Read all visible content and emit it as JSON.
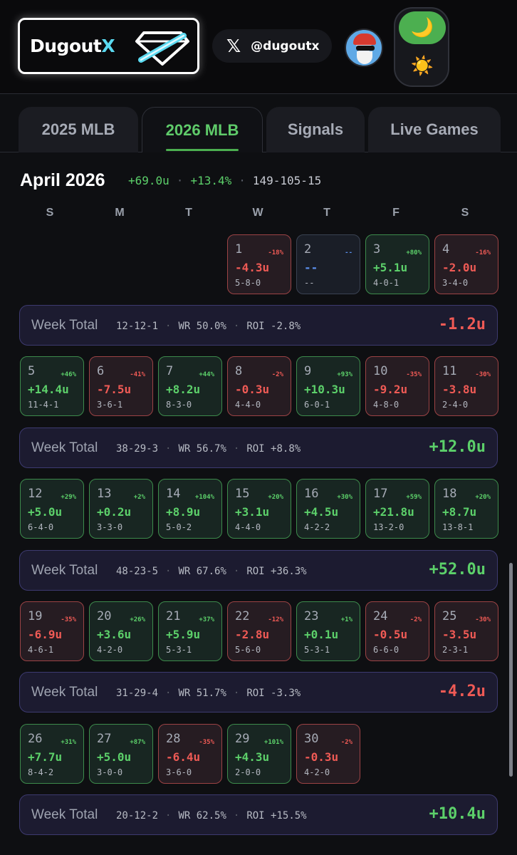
{
  "header": {
    "logo_text": "Dugout",
    "logo_accent": "X",
    "x_glyph": "𝕏",
    "x_handle": "@dugoutx",
    "moon_glyph": "🌙",
    "sun_glyph": "☀️"
  },
  "tabs": [
    {
      "label": "2025 MLB",
      "active": false
    },
    {
      "label": "2026 MLB",
      "active": true
    },
    {
      "label": "Signals",
      "active": false
    },
    {
      "label": "Live Games",
      "active": false
    }
  ],
  "month": {
    "title": "April 2026",
    "units": "+69.0u",
    "roi": "+13.4%",
    "record": "149-105-15",
    "sep": "·"
  },
  "weekdays": [
    "S",
    "M",
    "T",
    "W",
    "T",
    "F",
    "S"
  ],
  "weeks": [
    {
      "days": [
        {
          "col": 3,
          "num": "1",
          "pct": "-18%",
          "units": "-4.3u",
          "rec": "5-8-0",
          "status": "loss"
        },
        {
          "col": 4,
          "num": "2",
          "pct": "--",
          "units": "--",
          "rec": "--",
          "status": "empty"
        },
        {
          "col": 5,
          "num": "3",
          "pct": "+80%",
          "units": "+5.1u",
          "rec": "4-0-1",
          "status": "win"
        },
        {
          "col": 6,
          "num": "4",
          "pct": "-16%",
          "units": "-2.0u",
          "rec": "3-4-0",
          "status": "loss"
        }
      ],
      "total": {
        "label": "Week Total",
        "record": "12-12-1",
        "wr": "WR 50.0%",
        "roi": "ROI -2.8%",
        "units": "-1.2u",
        "status": "loss"
      }
    },
    {
      "days": [
        {
          "col": 0,
          "num": "5",
          "pct": "+46%",
          "units": "+14.4u",
          "rec": "11-4-1",
          "status": "win"
        },
        {
          "col": 1,
          "num": "6",
          "pct": "-41%",
          "units": "-7.5u",
          "rec": "3-6-1",
          "status": "loss"
        },
        {
          "col": 2,
          "num": "7",
          "pct": "+44%",
          "units": "+8.2u",
          "rec": "8-3-0",
          "status": "win"
        },
        {
          "col": 3,
          "num": "8",
          "pct": "-2%",
          "units": "-0.3u",
          "rec": "4-4-0",
          "status": "loss"
        },
        {
          "col": 4,
          "num": "9",
          "pct": "+93%",
          "units": "+10.3u",
          "rec": "6-0-1",
          "status": "win"
        },
        {
          "col": 5,
          "num": "10",
          "pct": "-35%",
          "units": "-9.2u",
          "rec": "4-8-0",
          "status": "loss"
        },
        {
          "col": 6,
          "num": "11",
          "pct": "-30%",
          "units": "-3.8u",
          "rec": "2-4-0",
          "status": "loss"
        }
      ],
      "total": {
        "label": "Week Total",
        "record": "38-29-3",
        "wr": "WR 56.7%",
        "roi": "ROI +8.8%",
        "units": "+12.0u",
        "status": "win"
      }
    },
    {
      "days": [
        {
          "col": 0,
          "num": "12",
          "pct": "+29%",
          "units": "+5.0u",
          "rec": "6-4-0",
          "status": "win"
        },
        {
          "col": 1,
          "num": "13",
          "pct": "+2%",
          "units": "+0.2u",
          "rec": "3-3-0",
          "status": "win"
        },
        {
          "col": 2,
          "num": "14",
          "pct": "+104%",
          "units": "+8.9u",
          "rec": "5-0-2",
          "status": "win"
        },
        {
          "col": 3,
          "num": "15",
          "pct": "+20%",
          "units": "+3.1u",
          "rec": "4-4-0",
          "status": "win"
        },
        {
          "col": 4,
          "num": "16",
          "pct": "+30%",
          "units": "+4.5u",
          "rec": "4-2-2",
          "status": "win"
        },
        {
          "col": 5,
          "num": "17",
          "pct": "+59%",
          "units": "+21.8u",
          "rec": "13-2-0",
          "status": "win"
        },
        {
          "col": 6,
          "num": "18",
          "pct": "+20%",
          "units": "+8.7u",
          "rec": "13-8-1",
          "status": "win"
        }
      ],
      "total": {
        "label": "Week Total",
        "record": "48-23-5",
        "wr": "WR 67.6%",
        "roi": "ROI +36.3%",
        "units": "+52.0u",
        "status": "win"
      }
    },
    {
      "days": [
        {
          "col": 0,
          "num": "19",
          "pct": "-35%",
          "units": "-6.9u",
          "rec": "4-6-1",
          "status": "loss"
        },
        {
          "col": 1,
          "num": "20",
          "pct": "+26%",
          "units": "+3.6u",
          "rec": "4-2-0",
          "status": "win"
        },
        {
          "col": 2,
          "num": "21",
          "pct": "+37%",
          "units": "+5.9u",
          "rec": "5-3-1",
          "status": "win"
        },
        {
          "col": 3,
          "num": "22",
          "pct": "-12%",
          "units": "-2.8u",
          "rec": "5-6-0",
          "status": "loss"
        },
        {
          "col": 4,
          "num": "23",
          "pct": "+1%",
          "units": "+0.1u",
          "rec": "5-3-1",
          "status": "win"
        },
        {
          "col": 5,
          "num": "24",
          "pct": "-2%",
          "units": "-0.5u",
          "rec": "6-6-0",
          "status": "loss"
        },
        {
          "col": 6,
          "num": "25",
          "pct": "-30%",
          "units": "-3.5u",
          "rec": "2-3-1",
          "status": "loss"
        }
      ],
      "total": {
        "label": "Week Total",
        "record": "31-29-4",
        "wr": "WR 51.7%",
        "roi": "ROI -3.3%",
        "units": "-4.2u",
        "status": "loss"
      }
    },
    {
      "days": [
        {
          "col": 0,
          "num": "26",
          "pct": "+31%",
          "units": "+7.7u",
          "rec": "8-4-2",
          "status": "win"
        },
        {
          "col": 1,
          "num": "27",
          "pct": "+87%",
          "units": "+5.0u",
          "rec": "3-0-0",
          "status": "win"
        },
        {
          "col": 2,
          "num": "28",
          "pct": "-35%",
          "units": "-6.4u",
          "rec": "3-6-0",
          "status": "loss"
        },
        {
          "col": 3,
          "num": "29",
          "pct": "+101%",
          "units": "+4.3u",
          "rec": "2-0-0",
          "status": "win"
        },
        {
          "col": 4,
          "num": "30",
          "pct": "-2%",
          "units": "-0.3u",
          "rec": "4-2-0",
          "status": "loss"
        }
      ],
      "total": {
        "label": "Week Total",
        "record": "20-12-2",
        "wr": "WR 62.5%",
        "roi": "ROI +15.5%",
        "units": "+10.4u",
        "status": "win"
      }
    }
  ]
}
